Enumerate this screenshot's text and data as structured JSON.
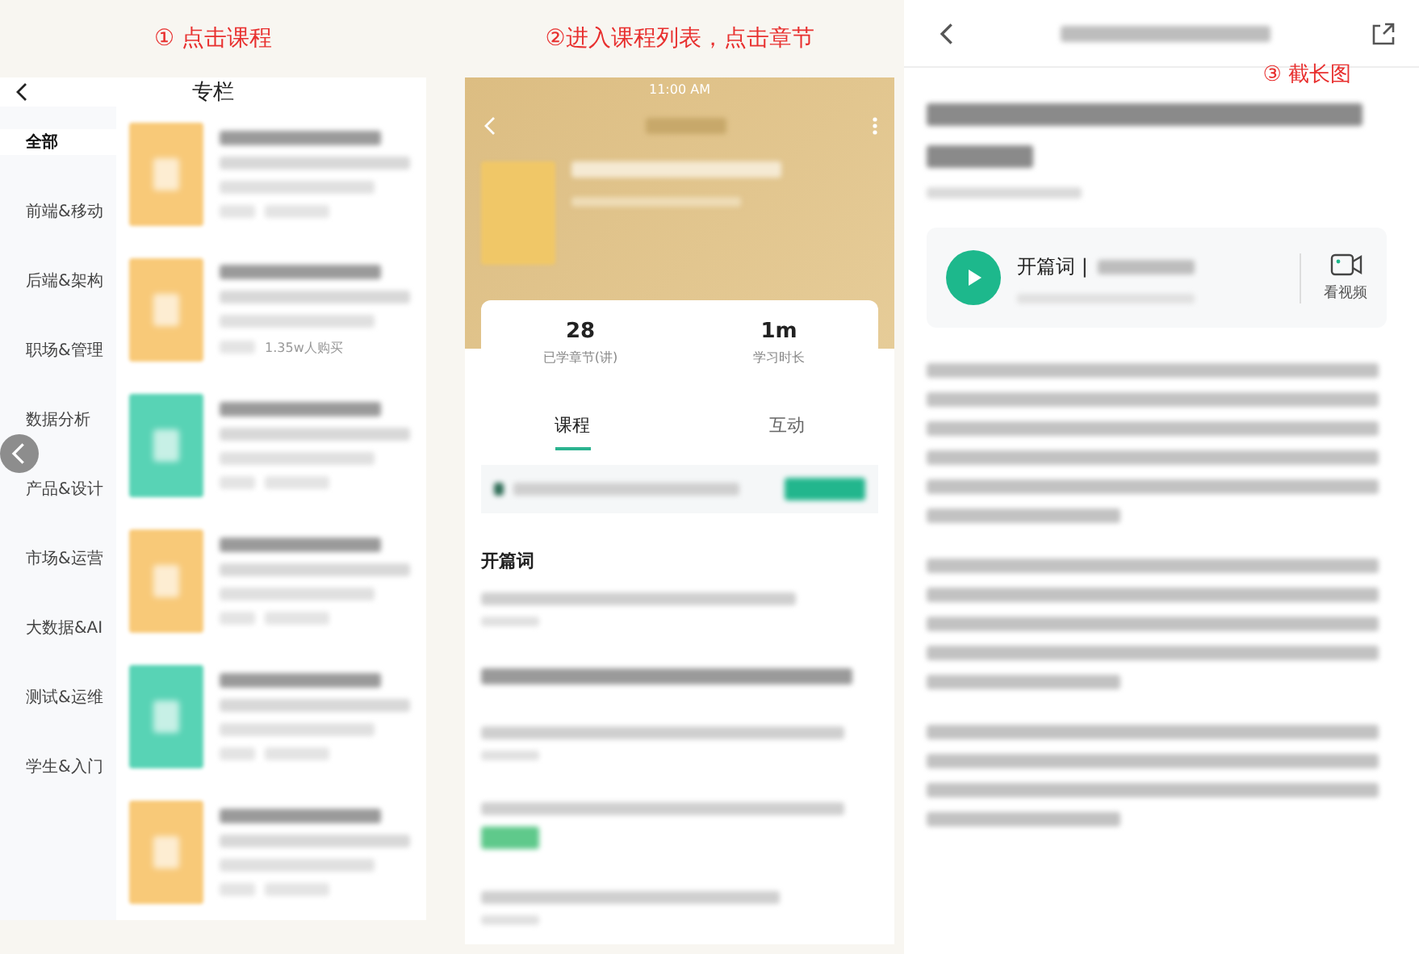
{
  "steps": [
    "① 点击课程",
    "②进入课程列表，点击章节",
    "③ 截长图"
  ],
  "column_page": {
    "title": "专栏",
    "categories": [
      {
        "label": "全部",
        "selected": true
      },
      {
        "label": "前端&移动",
        "selected": false
      },
      {
        "label": "后端&架构",
        "selected": false
      },
      {
        "label": "职场&管理",
        "selected": false
      },
      {
        "label": "数据分析",
        "selected": false
      },
      {
        "label": "产品&设计",
        "selected": false
      },
      {
        "label": "市场&运营",
        "selected": false
      },
      {
        "label": "大数据&AI",
        "selected": false
      },
      {
        "label": "测试&运维",
        "selected": false
      },
      {
        "label": "学生&入门",
        "selected": false
      }
    ],
    "courses": [
      {
        "color": "#f8c978"
      },
      {
        "color": "#f8c978",
        "buyers": "1.35w人购买"
      },
      {
        "color": "#58d3b5"
      },
      {
        "color": "#f8c978"
      },
      {
        "color": "#58d3b5"
      },
      {
        "color": "#f8c978"
      }
    ]
  },
  "course_page": {
    "status_time": "11:00 AM",
    "stats": [
      {
        "value": "28",
        "label": "已学章节(讲)"
      },
      {
        "value": "1m",
        "label": "学习时长"
      }
    ],
    "tabs": [
      {
        "label": "课程",
        "selected": true
      },
      {
        "label": "互动",
        "selected": false
      }
    ],
    "section_title": "开篇词"
  },
  "article_page": {
    "audio_title": "开篇词 |",
    "video_label": "看视频"
  }
}
